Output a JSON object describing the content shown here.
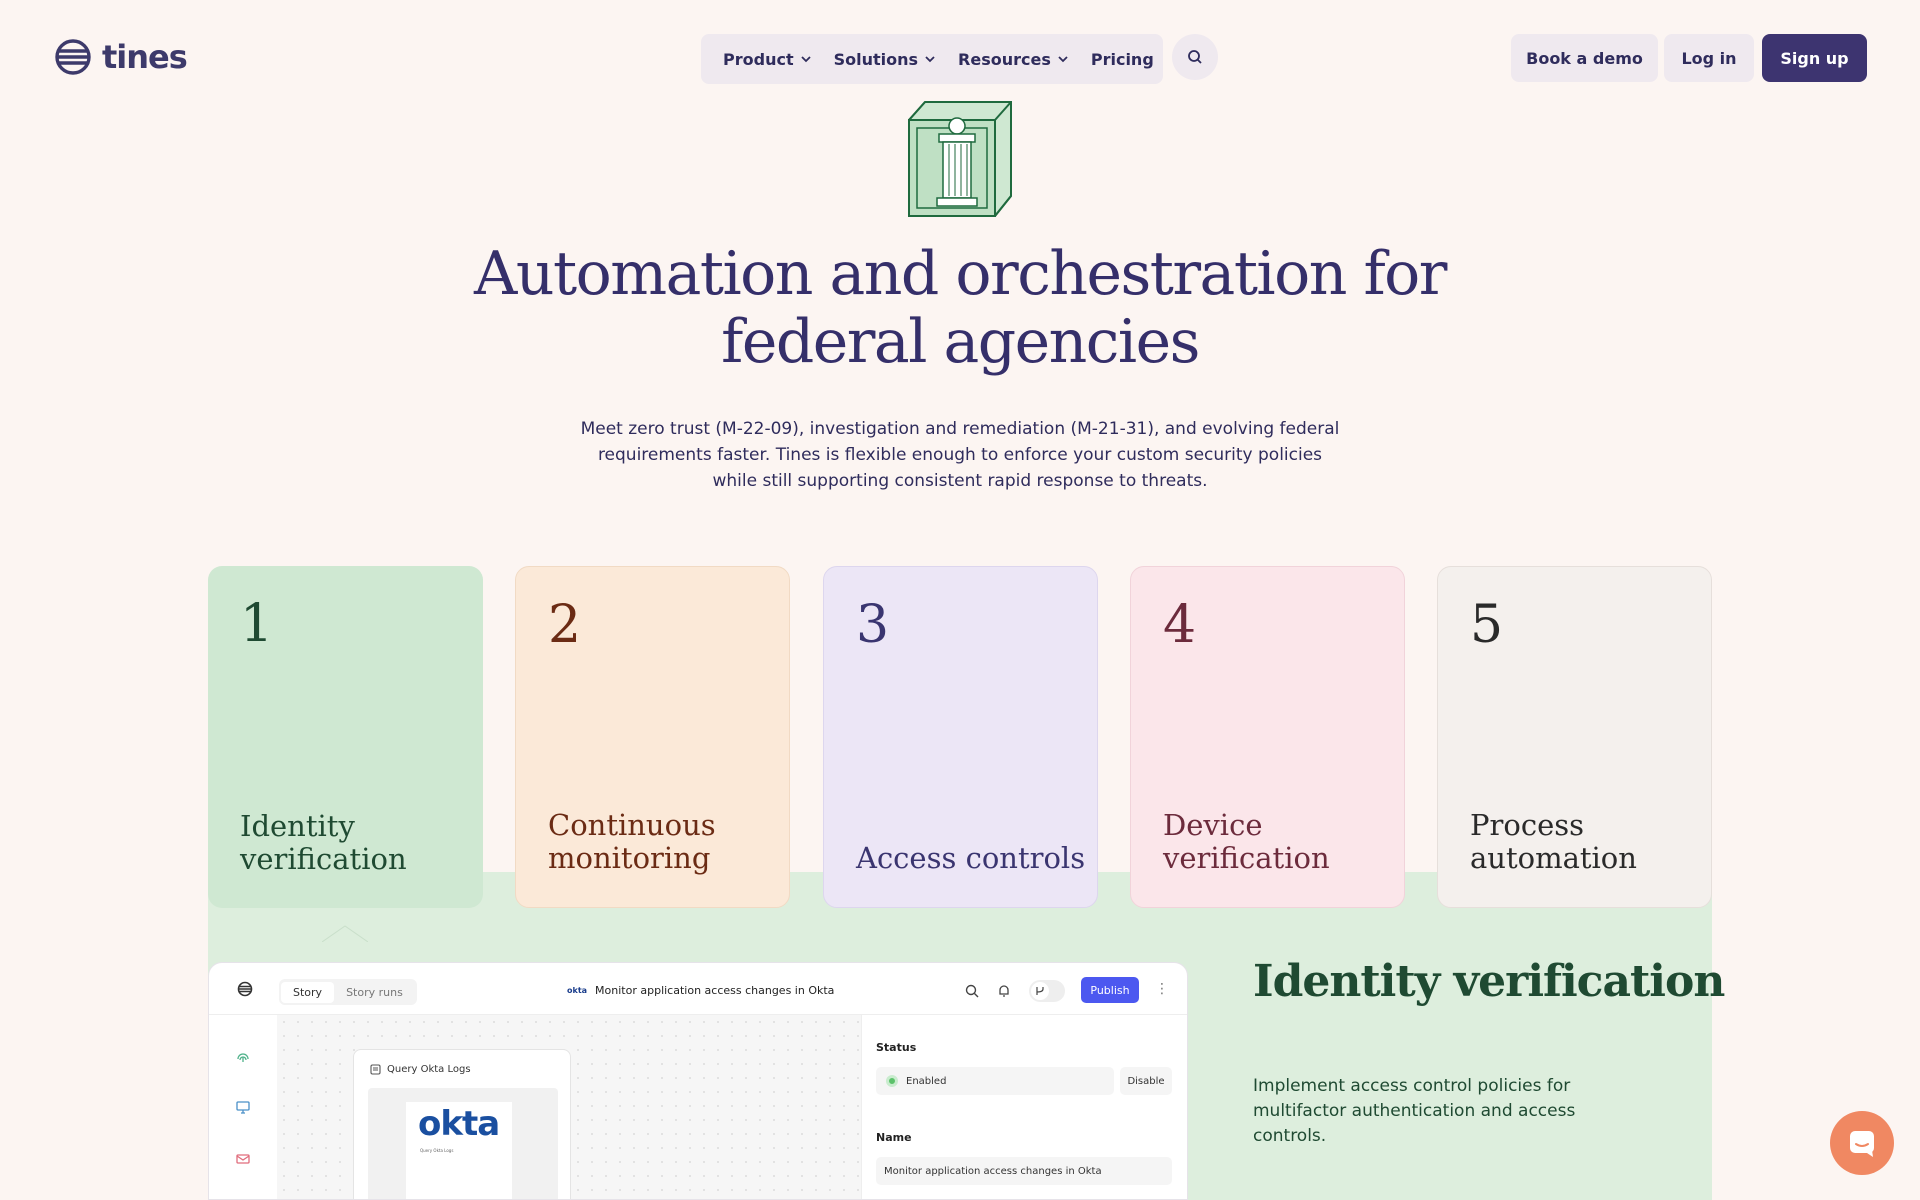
{
  "header": {
    "logo_text": "tines",
    "nav": [
      {
        "label": "Product",
        "has_dropdown": true
      },
      {
        "label": "Solutions",
        "has_dropdown": true
      },
      {
        "label": "Resources",
        "has_dropdown": true
      },
      {
        "label": "Pricing",
        "has_dropdown": false
      }
    ],
    "search_icon": "search-icon",
    "book_demo": "Book a demo",
    "log_in": "Log in",
    "sign_up": "Sign up"
  },
  "hero": {
    "title": "Automation and orchestration for federal agencies",
    "subtitle": "Meet zero trust (M-22-09), investigation and remediation (M-21-31), and evolving federal requirements faster. Tines is flexible enough to enforce your custom security policies while still supporting consistent rapid response to threats."
  },
  "cards": [
    {
      "num": "1",
      "label": "Identity verification",
      "color": "#cfe8d2"
    },
    {
      "num": "2",
      "label": "Continuous monitoring",
      "color": "#fbe9d8"
    },
    {
      "num": "3",
      "label": "Access controls",
      "color": "#ece6f6"
    },
    {
      "num": "4",
      "label": "Device verification",
      "color": "#fbe6ea"
    },
    {
      "num": "5",
      "label": "Process automation",
      "color": "#f4f0ed"
    }
  ],
  "app": {
    "tabs": [
      "Story",
      "Story runs"
    ],
    "okta_mini": "okta",
    "title": "Monitor application access changes in Okta",
    "publish": "Publish",
    "node_title": "Query Okta Logs",
    "okta_logo": "okta",
    "okta_caption": "Query Okta Logs",
    "status_label": "Status",
    "status_value": "Enabled",
    "disable": "Disable",
    "name_label": "Name",
    "name_value": "Monitor application access changes in Okta"
  },
  "detail": {
    "title": "Identity verification",
    "description": "Implement access control policies for multifactor authentication and access controls."
  },
  "chat_icon": "chat-icon"
}
